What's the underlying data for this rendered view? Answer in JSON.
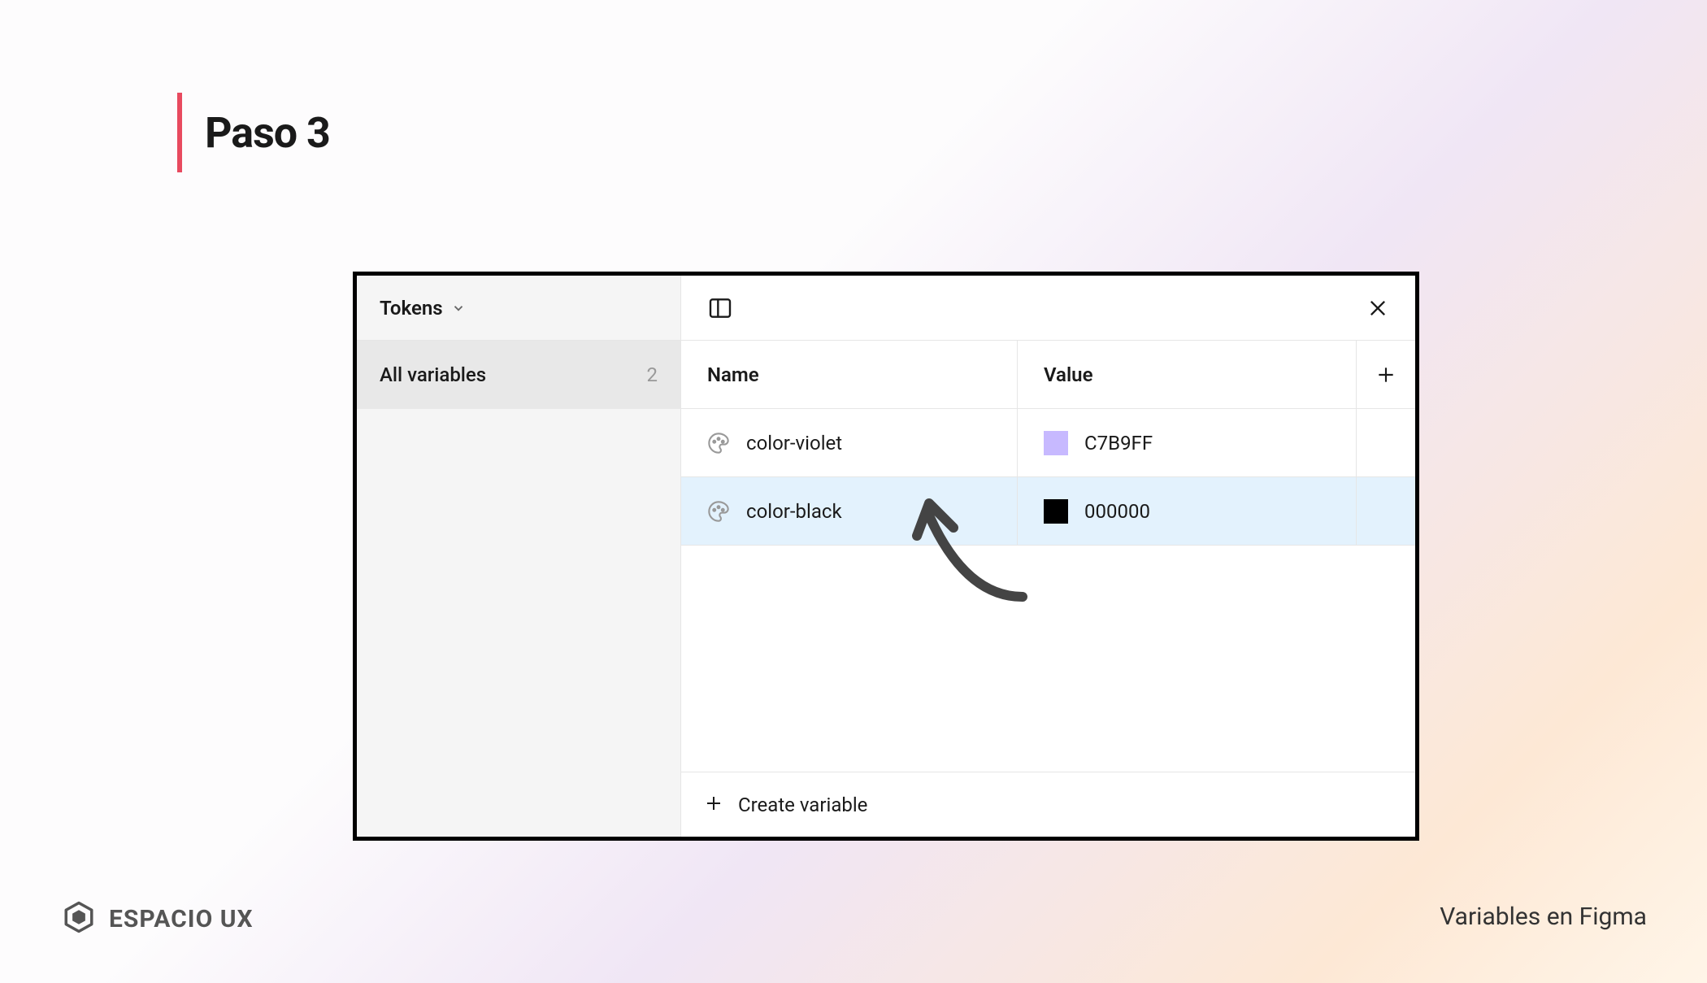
{
  "heading": "Paso 3",
  "sidebar": {
    "title": "Tokens",
    "all_variables_label": "All variables",
    "all_variables_count": "2"
  },
  "table": {
    "header_name": "Name",
    "header_value": "Value",
    "rows": [
      {
        "name": "color-violet",
        "hex": "C7B9FF",
        "swatch": "#C7B9FF",
        "selected": false
      },
      {
        "name": "color-black",
        "hex": "000000",
        "swatch": "#000000",
        "selected": true
      }
    ]
  },
  "footer_button": "Create variable",
  "brand": "ESPACIO UX",
  "footer_right": "Variables en Figma"
}
